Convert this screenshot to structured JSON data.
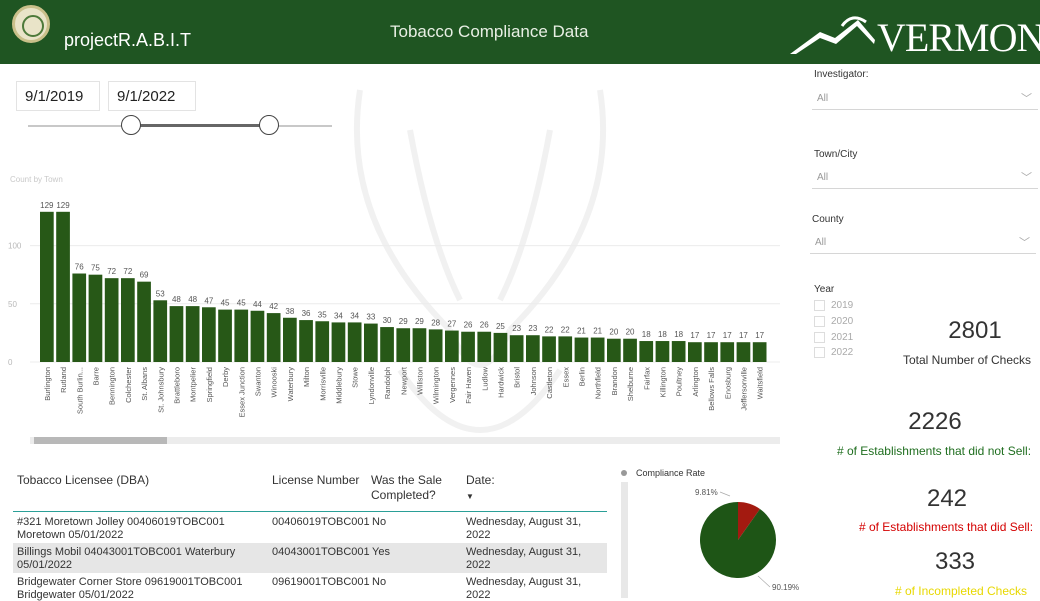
{
  "header": {
    "app_title": "projectR.A.B.I.T",
    "page_title": "Tobacco Compliance Data",
    "state_logo": "VERMONT",
    "bg_color": "#1f5522"
  },
  "date_range": {
    "start": "9/1/2019",
    "end": "9/1/2022"
  },
  "filters": {
    "investigator": {
      "label": "Investigator:",
      "value": "All"
    },
    "town": {
      "label": "Town/City",
      "value": "All"
    },
    "county": {
      "label": "County",
      "value": "All"
    },
    "year": {
      "label": "Year",
      "options": [
        "2019",
        "2020",
        "2021",
        "2022"
      ]
    }
  },
  "kpis": {
    "total_checks": {
      "value": "2801",
      "label": "Total Number of Checks",
      "color": "#333333"
    },
    "not_sell": {
      "value": "2226",
      "label": "# of Establishments that did not Sell:",
      "color": "#1f6e1f"
    },
    "did_sell": {
      "value": "242",
      "label": "# of Establishments that did Sell:",
      "color": "#d40000"
    },
    "incomplete": {
      "value": "333",
      "label": "# of Incompleted Checks",
      "color": "#e8d800"
    }
  },
  "chart_data": {
    "type": "bar",
    "title": "Count by Town",
    "categories": [
      "Burlington",
      "Rutland",
      "South Burlin...",
      "Barre",
      "Bennington",
      "Colchester",
      "St. Albans",
      "St. Johnsbury",
      "Brattleboro",
      "Montpelier",
      "Springfield",
      "Derby",
      "Essex Junction",
      "Swanton",
      "Winooski",
      "Waterbury",
      "Milton",
      "Morrisville",
      "Middlebury",
      "Stowe",
      "Lyndonville",
      "Randolph",
      "Newport",
      "Williston",
      "Wilmington",
      "Vergennes",
      "Fair Haven",
      "Ludlow",
      "Hardwick",
      "Bristol",
      "Johnson",
      "Castleton",
      "Essex",
      "Berlin",
      "Northfield",
      "Brandon",
      "Shelburne",
      "Fairfax",
      "Killington",
      "Poultney",
      "Arlington",
      "Bellows Falls",
      "Enosburg",
      "Jeffersonville",
      "Waitsfield"
    ],
    "values": [
      129,
      129,
      76,
      75,
      72,
      72,
      69,
      53,
      48,
      48,
      47,
      45,
      45,
      44,
      42,
      38,
      36,
      35,
      34,
      34,
      33,
      30,
      29,
      29,
      28,
      27,
      26,
      26,
      25,
      23,
      23,
      22,
      22,
      21,
      21,
      20,
      20,
      18,
      18,
      18,
      17,
      17,
      17,
      17,
      17
    ],
    "y_ticks": [
      "0",
      "50",
      "100"
    ],
    "ylim": [
      0,
      140
    ],
    "color": "#275817",
    "grid": true
  },
  "table": {
    "headers": [
      "Tobacco Licensee (DBA)",
      "License Number",
      "Was the Sale Completed?",
      "Date:"
    ],
    "rows": [
      {
        "dba": "#321 Moretown Jolley 00406019TOBC001 Moretown 05/01/2022",
        "license": "00406019TOBC001",
        "sale": "No",
        "date": "Wednesday, August 31, 2022"
      },
      {
        "dba": "Billings Mobil 04043001TOBC001 Waterbury 05/01/2022",
        "license": "04043001TOBC001",
        "sale": "Yes",
        "date": "Wednesday, August 31, 2022"
      },
      {
        "dba": "Bridgewater Corner Store 09619001TOBC001 Bridgewater 05/01/2022",
        "license": "09619001TOBC001",
        "sale": "No",
        "date": "Wednesday, August 31, 2022"
      }
    ]
  },
  "pie": {
    "title": "Compliance Rate",
    "slices": [
      {
        "label": "90.19%",
        "value": 90.19,
        "color": "#1e5516"
      },
      {
        "label": "9.81%",
        "value": 9.81,
        "color": "#a31a10"
      }
    ]
  }
}
